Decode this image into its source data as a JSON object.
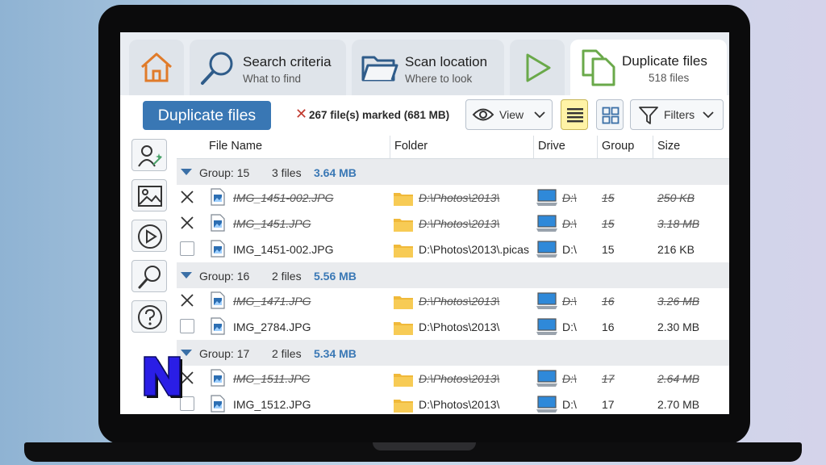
{
  "tabs": [
    {
      "name": "home",
      "title": "",
      "subtitle": ""
    },
    {
      "name": "search-criteria",
      "title": "Search criteria",
      "subtitle": "What to find"
    },
    {
      "name": "scan-location",
      "title": "Scan location",
      "subtitle": "Where to look"
    },
    {
      "name": "run",
      "title": "",
      "subtitle": ""
    },
    {
      "name": "duplicate-files",
      "title": "Duplicate files",
      "subtitle": "518 files"
    }
  ],
  "toolbar": {
    "duplicate_button": "Duplicate files",
    "marked_text": "267 file(s) marked (681 MB)",
    "view_label": "View",
    "filters_label": "Filters"
  },
  "columns": {
    "file_name": "File Name",
    "folder": "Folder",
    "drive": "Drive",
    "group": "Group",
    "size": "Size"
  },
  "groups": [
    {
      "label": "Group: 15",
      "files": "3 files",
      "size": "3.64 MB"
    },
    {
      "label": "Group: 16",
      "files": "2 files",
      "size": "5.56 MB"
    },
    {
      "label": "Group: 17",
      "files": "2 files",
      "size": "5.34 MB"
    }
  ],
  "rows": [
    {
      "name": "IMG_1451-002.JPG",
      "folder": "D:\\Photos\\2013\\",
      "drive": "D:\\",
      "group": "15",
      "size": "250 KB",
      "marked": true
    },
    {
      "name": "IMG_1451.JPG",
      "folder": "D:\\Photos\\2013\\",
      "drive": "D:\\",
      "group": "15",
      "size": "3.18 MB",
      "marked": true
    },
    {
      "name": "IMG_1451-002.JPG",
      "folder": "D:\\Photos\\2013\\.picas",
      "drive": "D:\\",
      "group": "15",
      "size": "216 KB",
      "marked": false
    },
    {
      "name": "IMG_1471.JPG",
      "folder": "D:\\Photos\\2013\\",
      "drive": "D:\\",
      "group": "16",
      "size": "3.26 MB",
      "marked": true
    },
    {
      "name": "IMG_2784.JPG",
      "folder": "D:\\Photos\\2013\\",
      "drive": "D:\\",
      "group": "16",
      "size": "2.30 MB",
      "marked": false
    },
    {
      "name": "IMG_1511.JPG",
      "folder": "D:\\Photos\\2013\\",
      "drive": "D:\\",
      "group": "17",
      "size": "2.64 MB",
      "marked": true
    },
    {
      "name": "IMG_1512.JPG",
      "folder": "D:\\Photos\\2013\\",
      "drive": "D:\\",
      "group": "17",
      "size": "2.70 MB",
      "marked": false
    }
  ],
  "colors": {
    "accent": "#3977b4",
    "group_size": "#3a78b5",
    "marked_x": "#c23a2f",
    "home_icon": "#e07b2a",
    "play_icon": "#6aa94a",
    "duplicate_icon": "#6aa94a"
  },
  "icons": {
    "sidebar": [
      "user-magic-icon",
      "image-icon",
      "play-circle-icon",
      "search-icon",
      "help-icon"
    ],
    "watermark": "N-logo"
  }
}
